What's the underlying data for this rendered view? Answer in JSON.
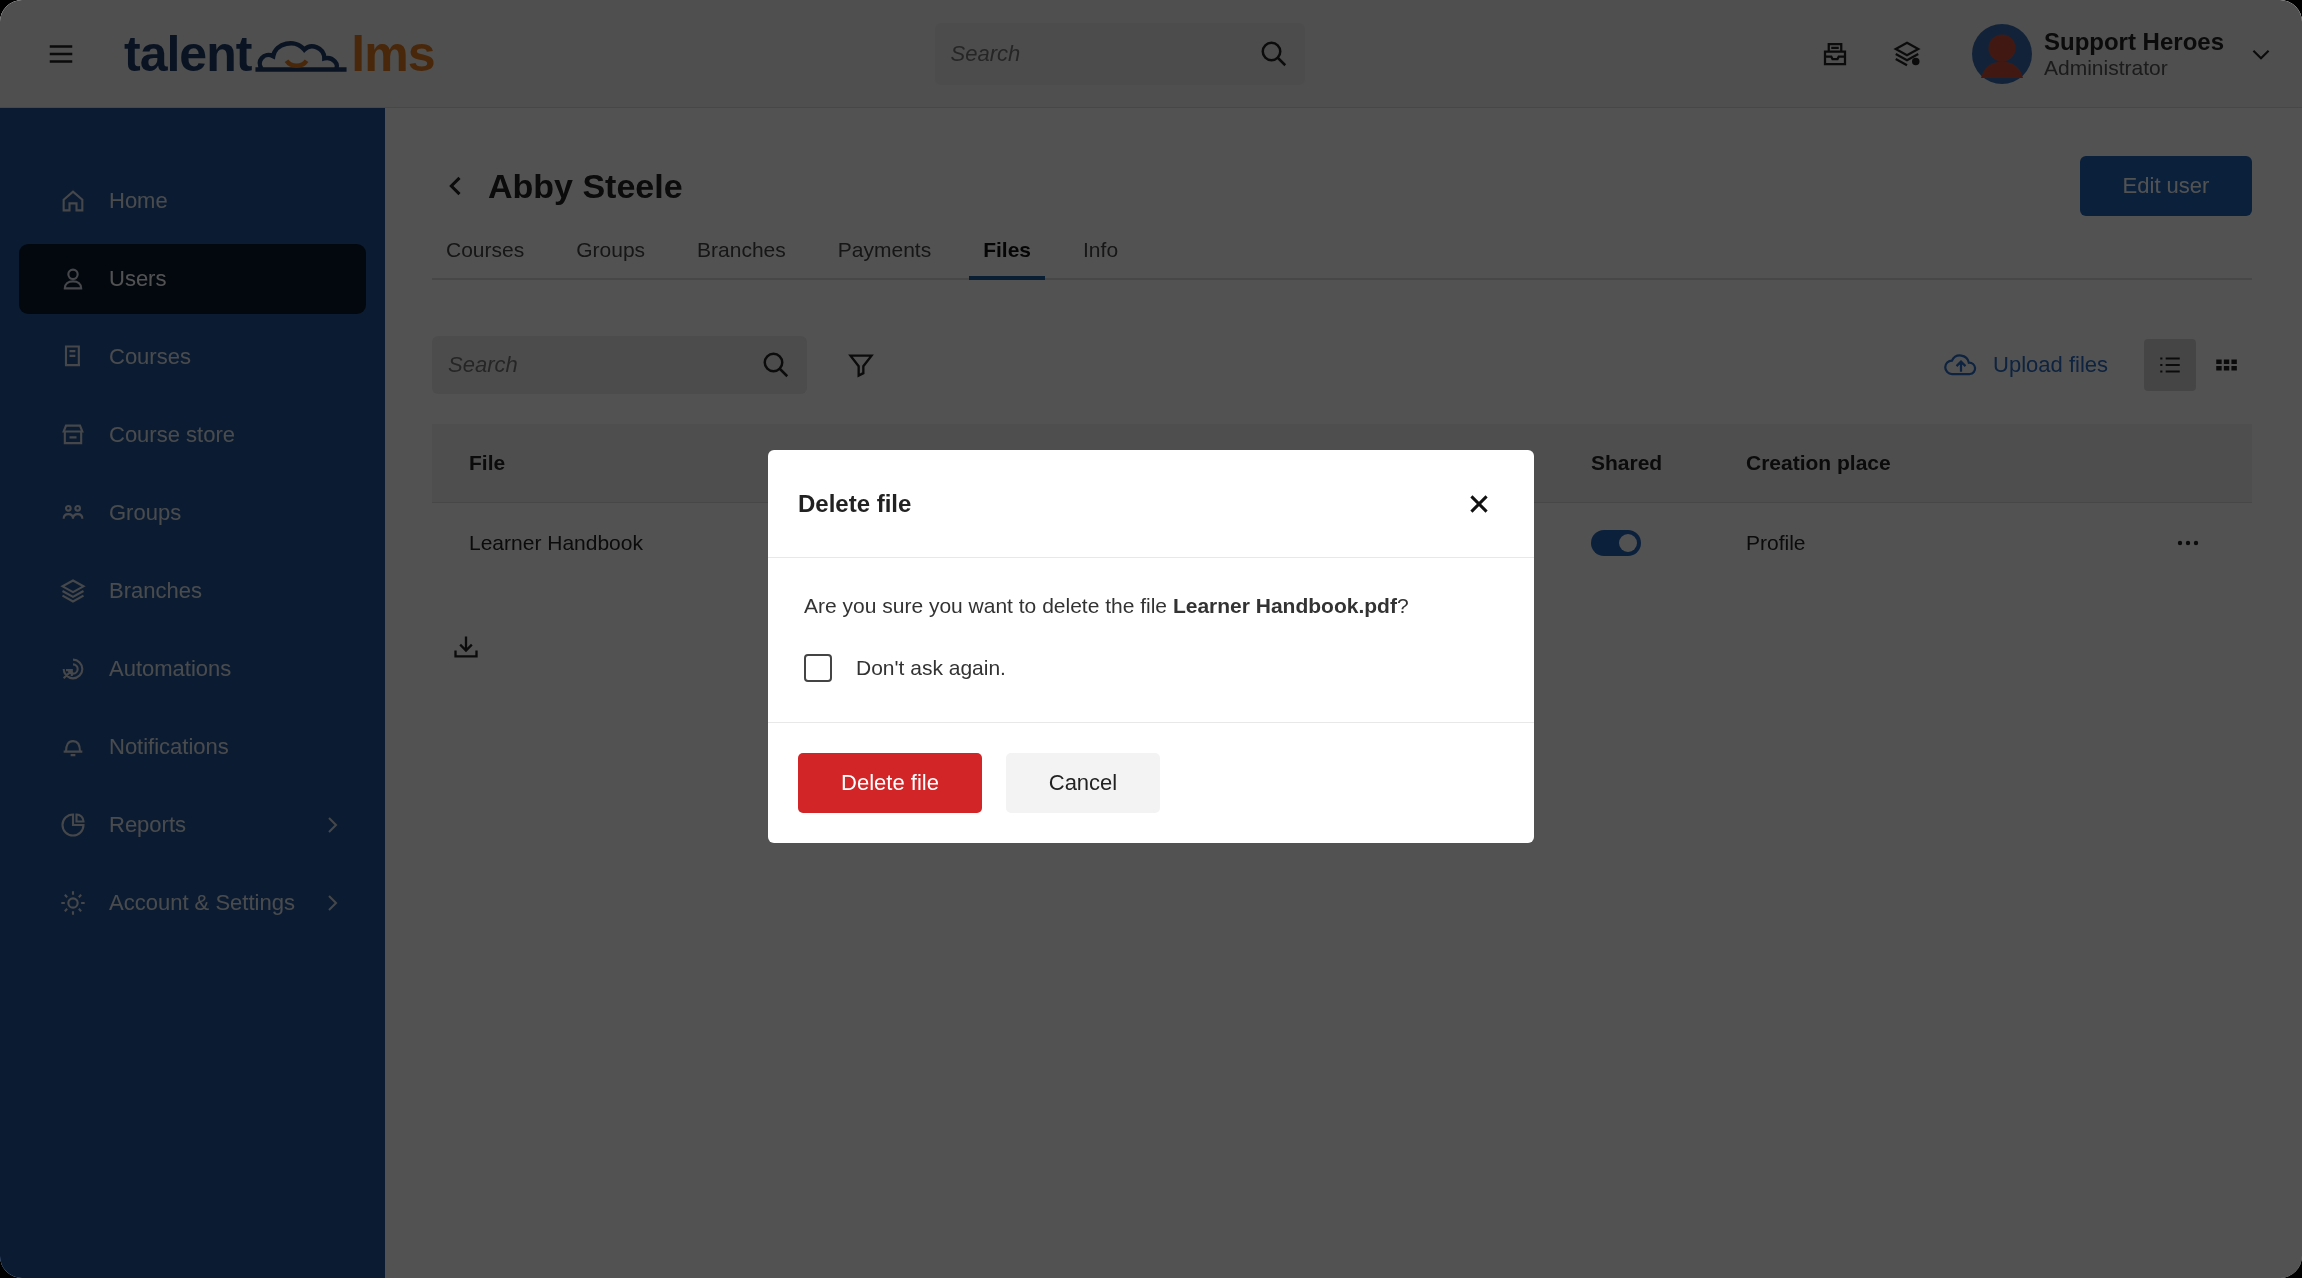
{
  "header": {
    "logo": {
      "left": "talent",
      "right": "lms"
    },
    "search": {
      "placeholder": "Search"
    },
    "user": {
      "name": "Support Heroes",
      "role": "Administrator"
    }
  },
  "sidebar": {
    "items": [
      {
        "label": "Home",
        "selected": false,
        "submenu": false
      },
      {
        "label": "Users",
        "selected": true,
        "submenu": false
      },
      {
        "label": "Courses",
        "selected": false,
        "submenu": false
      },
      {
        "label": "Course store",
        "selected": false,
        "submenu": false
      },
      {
        "label": "Groups",
        "selected": false,
        "submenu": false
      },
      {
        "label": "Branches",
        "selected": false,
        "submenu": false
      },
      {
        "label": "Automations",
        "selected": false,
        "submenu": false
      },
      {
        "label": "Notifications",
        "selected": false,
        "submenu": false
      },
      {
        "label": "Reports",
        "selected": false,
        "submenu": true
      },
      {
        "label": "Account & Settings",
        "selected": false,
        "submenu": true
      }
    ]
  },
  "page": {
    "title": "Abby Steele",
    "edit_button": "Edit user",
    "tabs": [
      {
        "label": "Courses",
        "selected": false
      },
      {
        "label": "Groups",
        "selected": false
      },
      {
        "label": "Branches",
        "selected": false
      },
      {
        "label": "Payments",
        "selected": false
      },
      {
        "label": "Files",
        "selected": true
      },
      {
        "label": "Info",
        "selected": false
      }
    ],
    "search": {
      "placeholder": "Search"
    },
    "upload_button": "Upload files",
    "view_modes": [
      {
        "kind": "list",
        "selected": true
      },
      {
        "kind": "grid",
        "selected": false
      }
    ],
    "table": {
      "columns": [
        "File",
        "Shared",
        "Creation place"
      ],
      "rows": [
        {
          "file": "Learner Handbook",
          "shared": true,
          "creation_place": "Profile"
        }
      ]
    }
  },
  "dialog": {
    "title": "Delete file",
    "message": "Are you sure you want to delete the file **Learner Handbook.pdf**?",
    "checkbox": {
      "label": "Don't ask again.",
      "checked": false
    },
    "buttons": [
      {
        "label": "Delete file",
        "kind": "danger"
      },
      {
        "label": "Cancel",
        "kind": "secondary"
      }
    ]
  }
}
